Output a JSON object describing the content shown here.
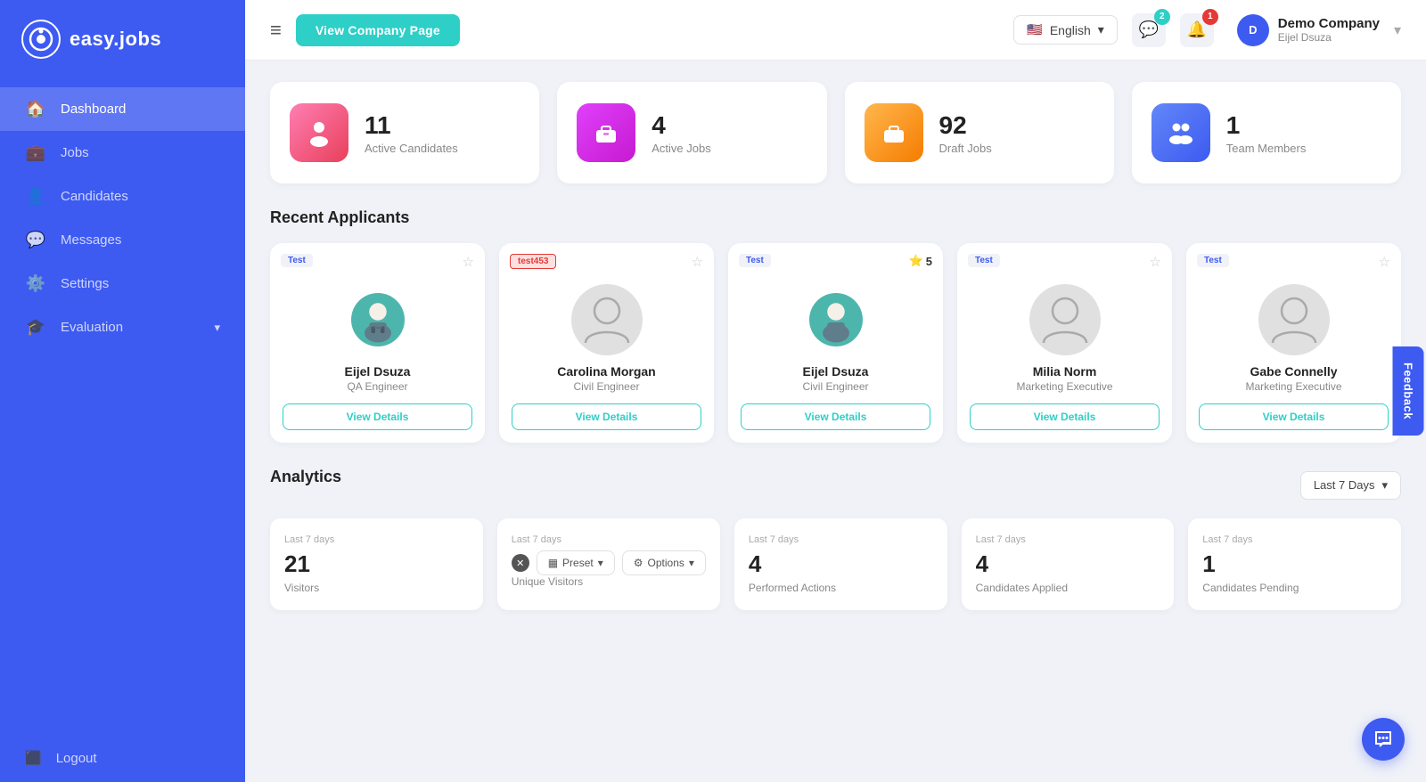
{
  "sidebar": {
    "logo_text": "easy.jobs",
    "items": [
      {
        "id": "dashboard",
        "label": "Dashboard",
        "icon": "🏠",
        "active": true
      },
      {
        "id": "jobs",
        "label": "Jobs",
        "icon": "💼",
        "active": false
      },
      {
        "id": "candidates",
        "label": "Candidates",
        "icon": "👤",
        "active": false
      },
      {
        "id": "messages",
        "label": "Messages",
        "icon": "💬",
        "active": false
      },
      {
        "id": "settings",
        "label": "Settings",
        "icon": "⚙️",
        "active": false
      },
      {
        "id": "evaluation",
        "label": "Evaluation",
        "icon": "🎓",
        "active": false,
        "has_chevron": true
      }
    ],
    "logout_label": "Logout"
  },
  "header": {
    "company_page_btn": "View Company Page",
    "language": "English",
    "company_name": "Demo Company",
    "company_user": "Eijel Dsuza",
    "notification_count": 1,
    "message_count": 2
  },
  "stats": [
    {
      "id": "active-candidates",
      "number": "11",
      "label": "Active Candidates",
      "icon_type": "pink"
    },
    {
      "id": "active-jobs",
      "number": "4",
      "label": "Active Jobs",
      "icon_type": "magenta"
    },
    {
      "id": "draft-jobs",
      "number": "92",
      "label": "Draft Jobs",
      "icon_type": "orange"
    },
    {
      "id": "team-members",
      "number": "1",
      "label": "Team Members",
      "icon_type": "blue"
    }
  ],
  "recent_applicants": {
    "section_title": "Recent Applicants",
    "cards": [
      {
        "id": "card-1",
        "tag": "Test",
        "tag_type": "normal",
        "name": "Eijel Dsuza",
        "role": "QA Engineer",
        "has_photo": true,
        "star": "☆",
        "btn": "View Details"
      },
      {
        "id": "card-2",
        "tag": "test453",
        "tag_type": "test453",
        "name": "Carolina Morgan",
        "role": "Civil Engineer",
        "has_photo": false,
        "star": "☆",
        "btn": "View Details"
      },
      {
        "id": "card-3",
        "tag": "Test",
        "tag_type": "normal",
        "name": "Eijel Dsuza",
        "role": "Civil Engineer",
        "has_photo": true,
        "star": "⭐",
        "rating": "5",
        "btn": "View Details"
      },
      {
        "id": "card-4",
        "tag": "Test",
        "tag_type": "normal",
        "name": "Milia Norm",
        "role": "Marketing Executive",
        "has_photo": false,
        "star": "☆",
        "btn": "View Details"
      },
      {
        "id": "card-5",
        "tag": "Test",
        "tag_type": "normal",
        "name": "Gabe Connelly",
        "role": "Marketing Executive",
        "has_photo": false,
        "star": "☆",
        "btn": "View Details"
      }
    ]
  },
  "analytics": {
    "section_title": "Analytics",
    "filter_label": "Last 7 Days",
    "cards": [
      {
        "id": "visitors",
        "period": "Last 7 days",
        "value": "21",
        "label": "Visitors"
      },
      {
        "id": "unique-visitors",
        "period": "Last 7 days",
        "value": "",
        "label": "Unique Visitors"
      },
      {
        "id": "performed-actions",
        "period": "Last 7 days",
        "value": "4",
        "label": "Performed Actions"
      },
      {
        "id": "candidates-applied",
        "period": "Last 7 days",
        "value": "4",
        "label": "Candidates Applied"
      },
      {
        "id": "candidates-pending",
        "period": "Last 7 days",
        "value": "1",
        "label": "Candidates Pending"
      }
    ],
    "preset_label": "Preset",
    "options_label": "Options"
  },
  "feedback_label": "Feedback",
  "chat_icon": "💬"
}
